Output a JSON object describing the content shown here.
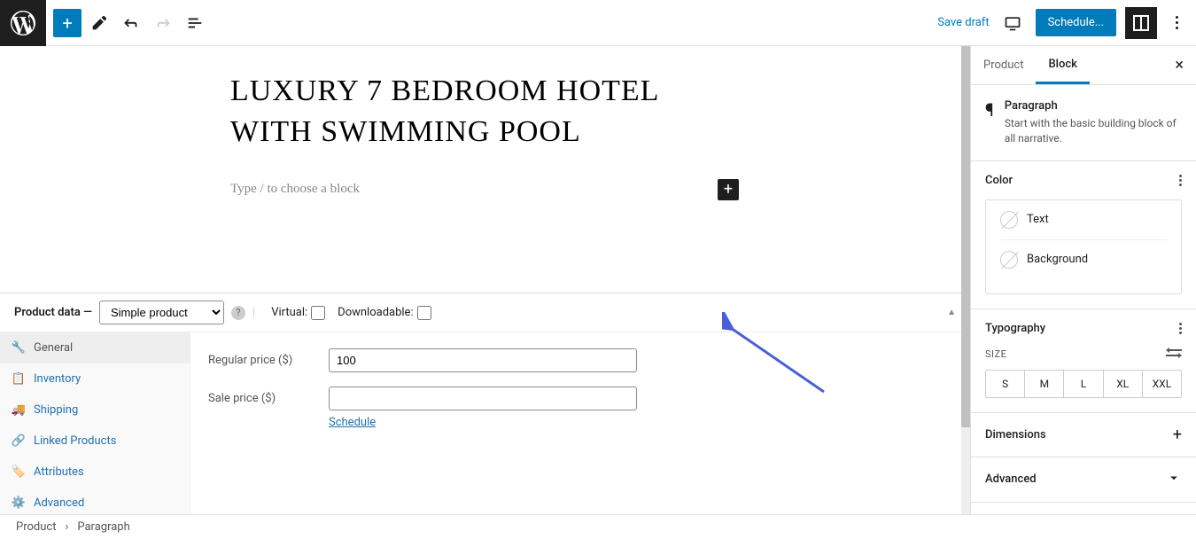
{
  "topbar": {
    "save_draft": "Save draft",
    "schedule": "Schedule..."
  },
  "editor": {
    "title": "LUXURY 7 BEDROOM HOTEL WITH SWIMMING POOL",
    "paragraph_placeholder": "Type / to choose a block"
  },
  "product_data": {
    "header_label": "Product data —",
    "type_options": [
      "Simple product"
    ],
    "selected_type": "Simple product",
    "virtual_label": "Virtual:",
    "downloadable_label": "Downloadable:",
    "tabs": [
      {
        "label": "General",
        "active": true
      },
      {
        "label": "Inventory",
        "active": false
      },
      {
        "label": "Shipping",
        "active": false
      },
      {
        "label": "Linked Products",
        "active": false
      },
      {
        "label": "Attributes",
        "active": false
      },
      {
        "label": "Advanced",
        "active": false
      }
    ],
    "regular_price_label": "Regular price ($)",
    "regular_price_value": "100",
    "sale_price_label": "Sale price ($)",
    "sale_price_value": "",
    "schedule_link": "Schedule"
  },
  "sidebar": {
    "tabs": {
      "product": "Product",
      "block": "Block"
    },
    "block_info": {
      "title": "Paragraph",
      "desc": "Start with the basic building block of all narrative."
    },
    "panels": {
      "color": {
        "title": "Color",
        "text_label": "Text",
        "background_label": "Background"
      },
      "typography": {
        "title": "Typography",
        "size_label": "SIZE",
        "sizes": [
          "S",
          "M",
          "L",
          "XL",
          "XXL"
        ]
      },
      "dimensions": "Dimensions",
      "advanced": "Advanced"
    }
  },
  "breadcrumb": {
    "root": "Product",
    "current": "Paragraph"
  }
}
